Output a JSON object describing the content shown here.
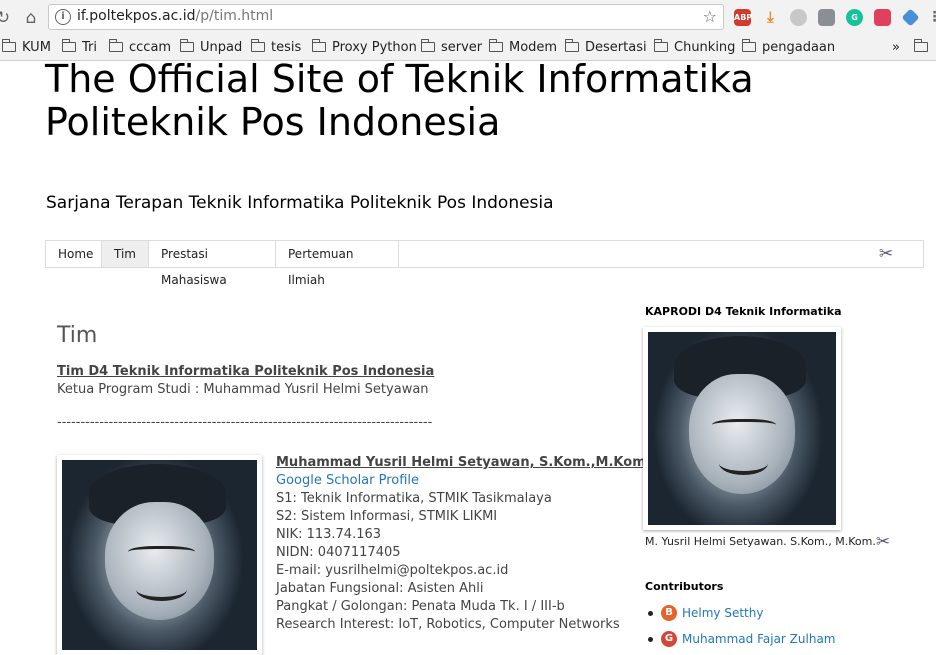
{
  "browser": {
    "url_host": "if.poltekpos.ac.id",
    "url_path": "/p/tim.html",
    "bookmarks": [
      "KUM",
      "Tri",
      "cccam",
      "Unpad",
      "tesis",
      "Proxy Python",
      "server",
      "Modem",
      "Desertasi",
      "Chunking",
      "pengadaan"
    ],
    "overflow_label": "»",
    "extensions": [
      "ABP"
    ]
  },
  "site": {
    "title": "The Official Site of Teknik Informatika Politeknik Pos Indonesia",
    "description": "Sarjana Terapan Teknik Informatika Politeknik Pos Indonesia"
  },
  "nav": {
    "tabs": [
      "Home",
      "Tim",
      "Prestasi Mahasiswa",
      "Pertemuan Ilmiah"
    ],
    "active": "Tim"
  },
  "post": {
    "title": "Tim",
    "heading_link": "Tim D4 Teknik Informatika Politeknik Pos Indonesia",
    "head_line": "Ketua Program Studi :  Muhammad Yusril Helmi Setyawan",
    "separator": "--------------------------------------------------------------------------------",
    "profile": {
      "name": "Muhammad Yusril Helmi Setyawan, S.Kom.,M.Kom.",
      "scholar_link": "Google Scholar Profile",
      "s1": "S1: Teknik Informatika, STMIK Tasikmalaya",
      "s2": "S2: Sistem Informasi, STMIK LIKMI",
      "nik": "NIK: 113.74.163",
      "nidn": "NIDN: 0407117405",
      "email": "E-mail: yusrilhelmi@poltekpos.ac.id",
      "jabatan": "Jabatan Fungsional: Asisten Ahli",
      "pangkat": "Pangkat / Golongan: Penata Muda Tk. I / III-b",
      "research": "Research Interest: IoT, Robotics, Computer Networks"
    }
  },
  "sidebar": {
    "kaprodi_heading": "KAPRODI D4 Teknik Informatika",
    "kaprodi_caption": "M. Yusril Helmi Setyawan. S.Kom., M.Kom.",
    "contributors_heading": "Contributors",
    "contributors": [
      "Helmy Setthy",
      "Muhammad Fajar Zulham"
    ]
  },
  "colors": {
    "link": "#2277bb",
    "tab_active": "#eeeeee",
    "text": "#444444"
  }
}
